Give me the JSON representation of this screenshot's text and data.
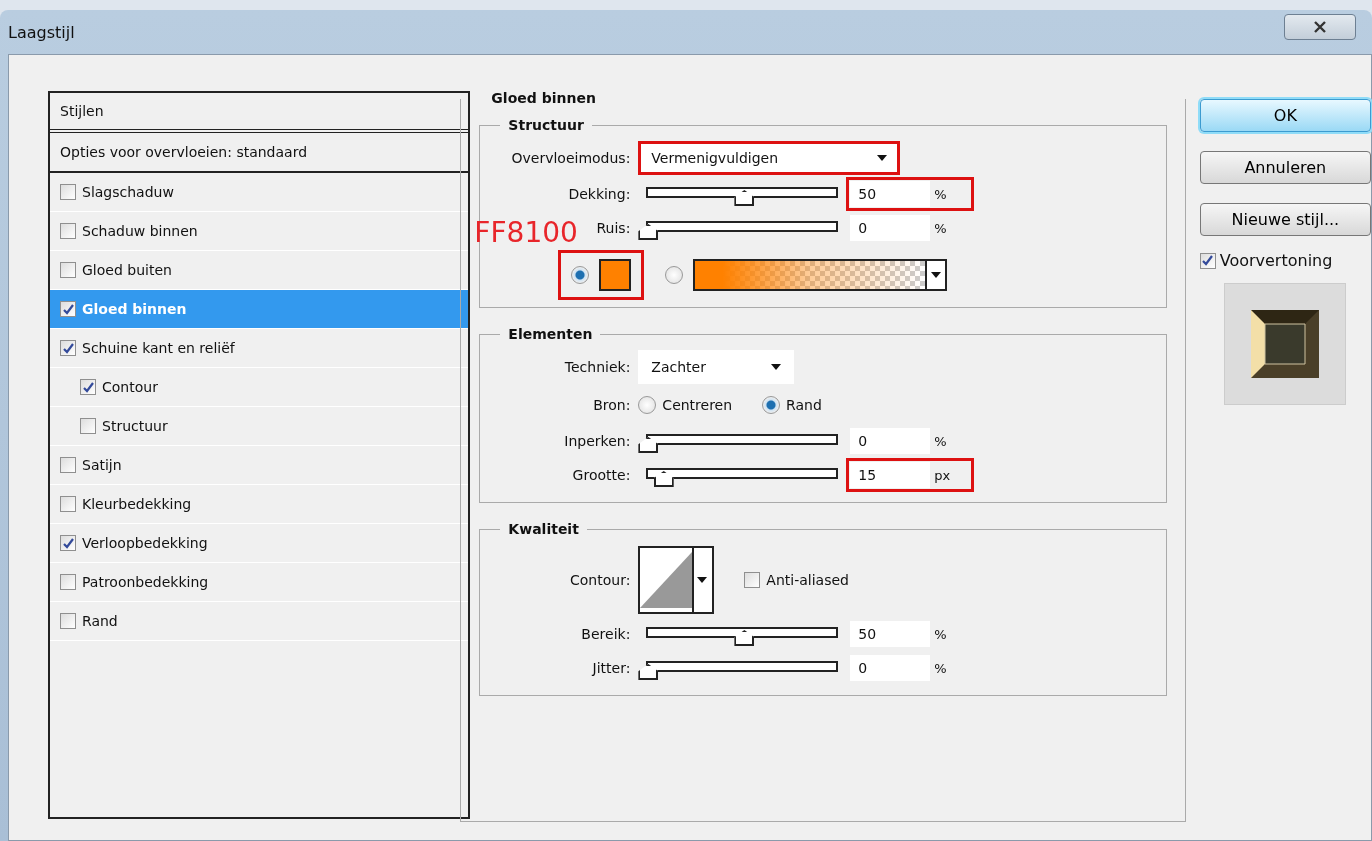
{
  "window": {
    "title": "Laagstijl"
  },
  "styles_list": {
    "header": "Stijlen",
    "blend_options": "Opties voor overvloeien: standaard",
    "items": [
      {
        "label": "Slagschaduw",
        "checked": false,
        "selected": false
      },
      {
        "label": "Schaduw binnen",
        "checked": false,
        "selected": false
      },
      {
        "label": "Gloed buiten",
        "checked": false,
        "selected": false
      },
      {
        "label": "Gloed binnen",
        "checked": true,
        "selected": true
      },
      {
        "label": "Schuine kant en reliëf",
        "checked": true,
        "selected": false,
        "children": [
          {
            "label": "Contour",
            "checked": true,
            "selected": false
          },
          {
            "label": "Structuur",
            "checked": false,
            "selected": false
          }
        ]
      },
      {
        "label": "Satijn",
        "checked": false,
        "selected": false
      },
      {
        "label": "Kleurbedekking",
        "checked": false,
        "selected": false
      },
      {
        "label": "Verloopbedekking",
        "checked": true,
        "selected": false
      },
      {
        "label": "Patroonbedekking",
        "checked": false,
        "selected": false
      },
      {
        "label": "Rand",
        "checked": false,
        "selected": false
      }
    ]
  },
  "panel": {
    "title": "Gloed binnen",
    "structure": {
      "title": "Structuur",
      "blend_mode": {
        "label": "Overvloeimodus:",
        "value": "Vermenigvuldigen",
        "highlighted": true
      },
      "sliders": [
        {
          "label": "Dekking:",
          "level": 0.5,
          "value": "50",
          "unit": "%",
          "highlighted": true
        },
        {
          "label": "Ruis:",
          "level": 0,
          "value": "0",
          "unit": "%",
          "highlighted": false
        }
      ],
      "annotation": "FF8100",
      "color_options": [
        {
          "kind": "swatch",
          "selected": true,
          "color": "#ff8100",
          "highlighted": true
        },
        {
          "kind": "gradient",
          "selected": false,
          "color": "#ff8100",
          "highlighted": false
        }
      ]
    },
    "elements": {
      "title": "Elementen",
      "technique": {
        "label": "Techniek:",
        "value": "Zachter"
      },
      "source": {
        "label": "Bron:",
        "options": [
          {
            "label": "Centreren",
            "selected": false
          },
          {
            "label": "Rand",
            "selected": true
          }
        ]
      },
      "sliders": [
        {
          "label": "Inperken:",
          "level": 0,
          "value": "0",
          "unit": "%",
          "highlighted": false
        },
        {
          "label": "Grootte:",
          "level": 0.08,
          "value": "15",
          "unit": "px",
          "highlighted": true
        }
      ]
    },
    "quality": {
      "title": "Kwaliteit",
      "contour_label": "Contour:",
      "anti_aliased": {
        "label": "Anti-aliased",
        "checked": false
      },
      "sliders": [
        {
          "label": "Bereik:",
          "level": 0.5,
          "value": "50",
          "unit": "%",
          "highlighted": false
        },
        {
          "label": "Jitter:",
          "level": 0,
          "value": "0",
          "unit": "%",
          "highlighted": false
        }
      ]
    }
  },
  "buttons": [
    {
      "label": "OK",
      "default": true
    },
    {
      "label": "Annuleren",
      "default": false
    },
    {
      "label": "Nieuwe stijl...",
      "default": false
    }
  ],
  "preview": {
    "label": "Voorvertoning",
    "checked": true
  }
}
